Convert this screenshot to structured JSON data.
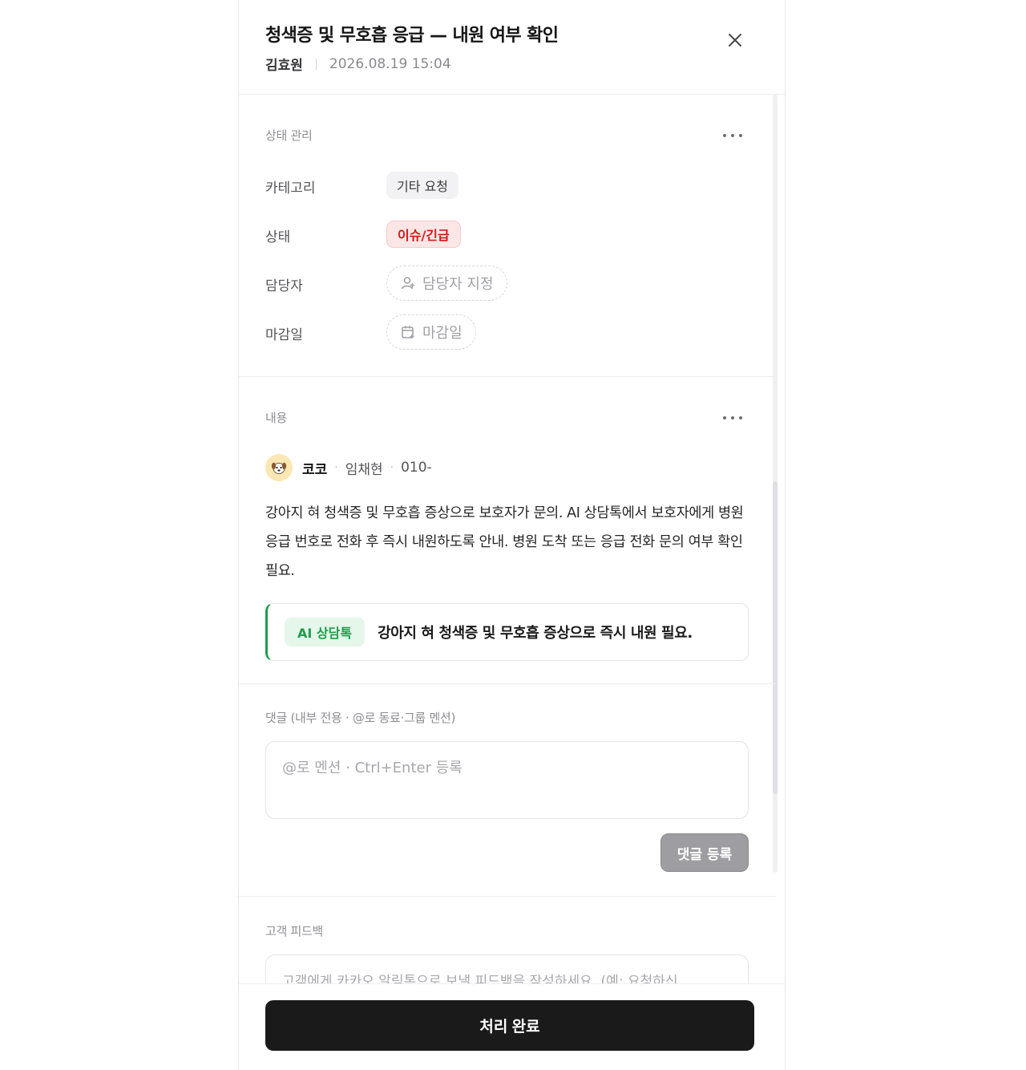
{
  "header": {
    "title": "청색증 및 무호흡 응급 — 내원 여부 확인",
    "author": "김효원",
    "datetime": "2026.08.19 15:04"
  },
  "status_section": {
    "title": "상태 관리",
    "fields": {
      "category": {
        "label": "카테고리",
        "value": "기타 요청"
      },
      "status": {
        "label": "상태",
        "value": "이슈/긴급",
        "color": "#d21a1a"
      },
      "assignee": {
        "label": "담당자",
        "placeholder": "담당자 지정"
      },
      "due": {
        "label": "마감일",
        "placeholder": "마감일"
      }
    }
  },
  "content_section": {
    "title": "내용",
    "pet_name": "코코",
    "guardian_name": "임채현",
    "phone": "010-",
    "body": "강아지 혀 청색증 및 무호흡 증상으로 보호자가 문의. AI 상담톡에서 보호자에게 병원 응급 번호로 전화 후 즉시 내원하도록 안내. 병원 도착 또는 응급 전화 문의 여부 확인 필요.",
    "ai_badge": "AI 상담톡",
    "ai_summary": "강아지 혀 청색증 및 무호흡 증상으로 즉시 내원 필요.",
    "accent_color": "#1f9d4c"
  },
  "comment_section": {
    "title": "댓글 (내부 전용 · @로 동료·그룹 멘션)",
    "placeholder": "@로 멘션 · Ctrl+Enter 등록",
    "submit_label": "댓글 등록"
  },
  "feedback_section": {
    "title": "고객 피드백",
    "placeholder": "고객에게 카카오 알림톡으로 보낼 피드백을 작성하세요. (예: 요청하신"
  },
  "footer": {
    "complete_label": "처리 완료"
  }
}
